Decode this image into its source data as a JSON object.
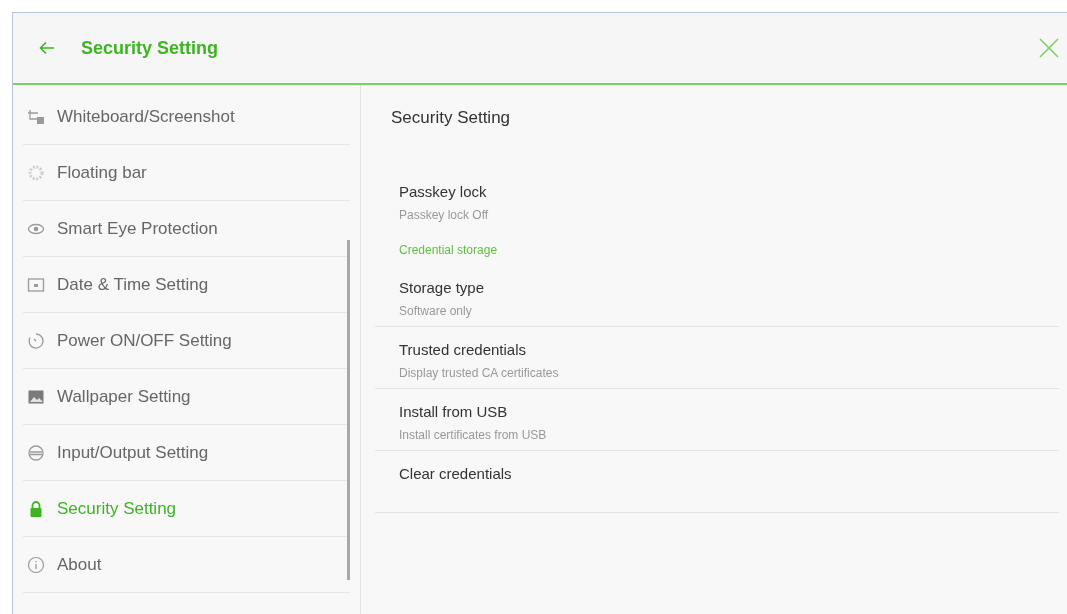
{
  "header": {
    "title": "Security Setting"
  },
  "sidebar": {
    "items": [
      {
        "label": "Whiteboard/Screenshot",
        "kind": "whiteboard",
        "selected": false
      },
      {
        "label": "Floating bar",
        "kind": "floating",
        "selected": false
      },
      {
        "label": "Smart Eye Protection",
        "kind": "eye",
        "selected": false
      },
      {
        "label": "Date & Time Setting",
        "kind": "calendar",
        "selected": false
      },
      {
        "label": "Power ON/OFF Setting",
        "kind": "power",
        "selected": false
      },
      {
        "label": "Wallpaper Setting",
        "kind": "wallpaper",
        "selected": false
      },
      {
        "label": "Input/Output Setting",
        "kind": "io",
        "selected": false
      },
      {
        "label": "Security Setting",
        "kind": "lock",
        "selected": true
      },
      {
        "label": "About",
        "kind": "info",
        "selected": false
      }
    ]
  },
  "panel": {
    "title": "Security Setting",
    "entries": [
      {
        "kind": "item",
        "title": "Passkey lock",
        "subtitle": "Passkey lock Off"
      },
      {
        "kind": "section",
        "title": "Credential storage"
      },
      {
        "kind": "item",
        "title": "Storage type",
        "subtitle": "Software only"
      },
      {
        "kind": "item",
        "title": "Trusted credentials",
        "subtitle": "Display trusted CA certificates"
      },
      {
        "kind": "item",
        "title": "Install from USB",
        "subtitle": "Install certificates from USB"
      },
      {
        "kind": "item",
        "title": "Clear credentials"
      }
    ]
  }
}
